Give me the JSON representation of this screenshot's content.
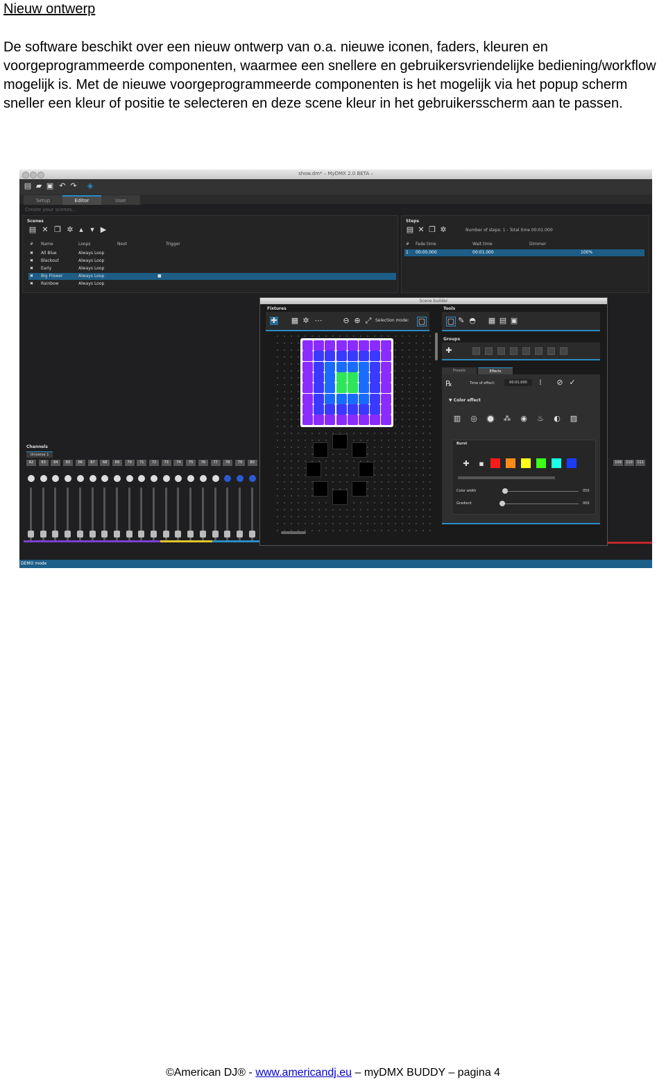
{
  "heading": "Nieuw ontwerp",
  "intro": "De software beschikt over een nieuw ontwerp van o.a. nieuwe iconen, faders, kleuren en voorgeprogrammeerde componenten, waarmee een snellere en gebruikersvriendelijke bediening/workflow mogelijk is.  Met de nieuwe voorgeprogrammeerde componenten is het mogelijk via het popup scherm sneller  een kleur of positie te selecteren en deze scene kleur in het gebruikersscherm aan te passen.",
  "screenshot": {
    "window_title": "show.dm* – MyDMX 2.0 BETA –",
    "tabs": [
      "Setup",
      "Editor",
      "User"
    ],
    "active_tab": "Editor",
    "sub_label": "Create your scenes...",
    "scenes": {
      "label": "Scenes",
      "columns": [
        "#",
        "Name",
        "Loops",
        "Next",
        "Trigger"
      ],
      "rows": [
        {
          "name": "All Blue",
          "loops": "Always Loop"
        },
        {
          "name": "Blackout",
          "loops": "Always Loop"
        },
        {
          "name": "Early",
          "loops": "Always Loop"
        },
        {
          "name": "Big Flower",
          "loops": "Always Loop"
        },
        {
          "name": "Rainbow",
          "loops": "Always Loop"
        }
      ],
      "selected_index": 3
    },
    "steps": {
      "label": "Steps",
      "info": "Number of steps: 1 - Total time 00:01:000",
      "columns": [
        "#",
        "Fade time",
        "Wait time",
        "Dimmer"
      ],
      "row": {
        "num": "1",
        "fade": "00:00.000",
        "wait": "00:01.000",
        "dimmer": "100%"
      }
    },
    "scene_builder": {
      "title": "Scene builder",
      "fixtures_label": "Fixtures",
      "selection_mode": "Selection mode:",
      "tools_label": "Tools",
      "groups_label": "Groups",
      "tabs": [
        "Presets",
        "Effects"
      ],
      "time_of_effect_label": "Time of effect:",
      "time_of_effect_value": "00:01:000",
      "color_effect_label": "Color effect",
      "burst_label": "Burst",
      "color_width_label": "Color width",
      "color_width_value": "050",
      "gradient_label": "Gradient",
      "gradient_value": "000",
      "swatches": [
        "#ff1a1a",
        "#ff8c1a",
        "#ffff1a",
        "#3cff1a",
        "#1affe6",
        "#1a3cff"
      ]
    },
    "channels": {
      "label": "Channels",
      "universe": "Universe 1",
      "numbers": [
        "62",
        "63",
        "64",
        "65",
        "66",
        "67",
        "68",
        "69",
        "70",
        "71",
        "72",
        "73",
        "74",
        "75",
        "76",
        "77",
        "78",
        "79",
        "80"
      ],
      "right_numbers": [
        "109",
        "110",
        "111"
      ]
    },
    "status": "DEMO mode"
  },
  "footer": {
    "prefix": "©American DJ® - ",
    "link": "www.americandj.eu",
    "suffix": " – myDMX BUDDY  –  pagina 4"
  }
}
